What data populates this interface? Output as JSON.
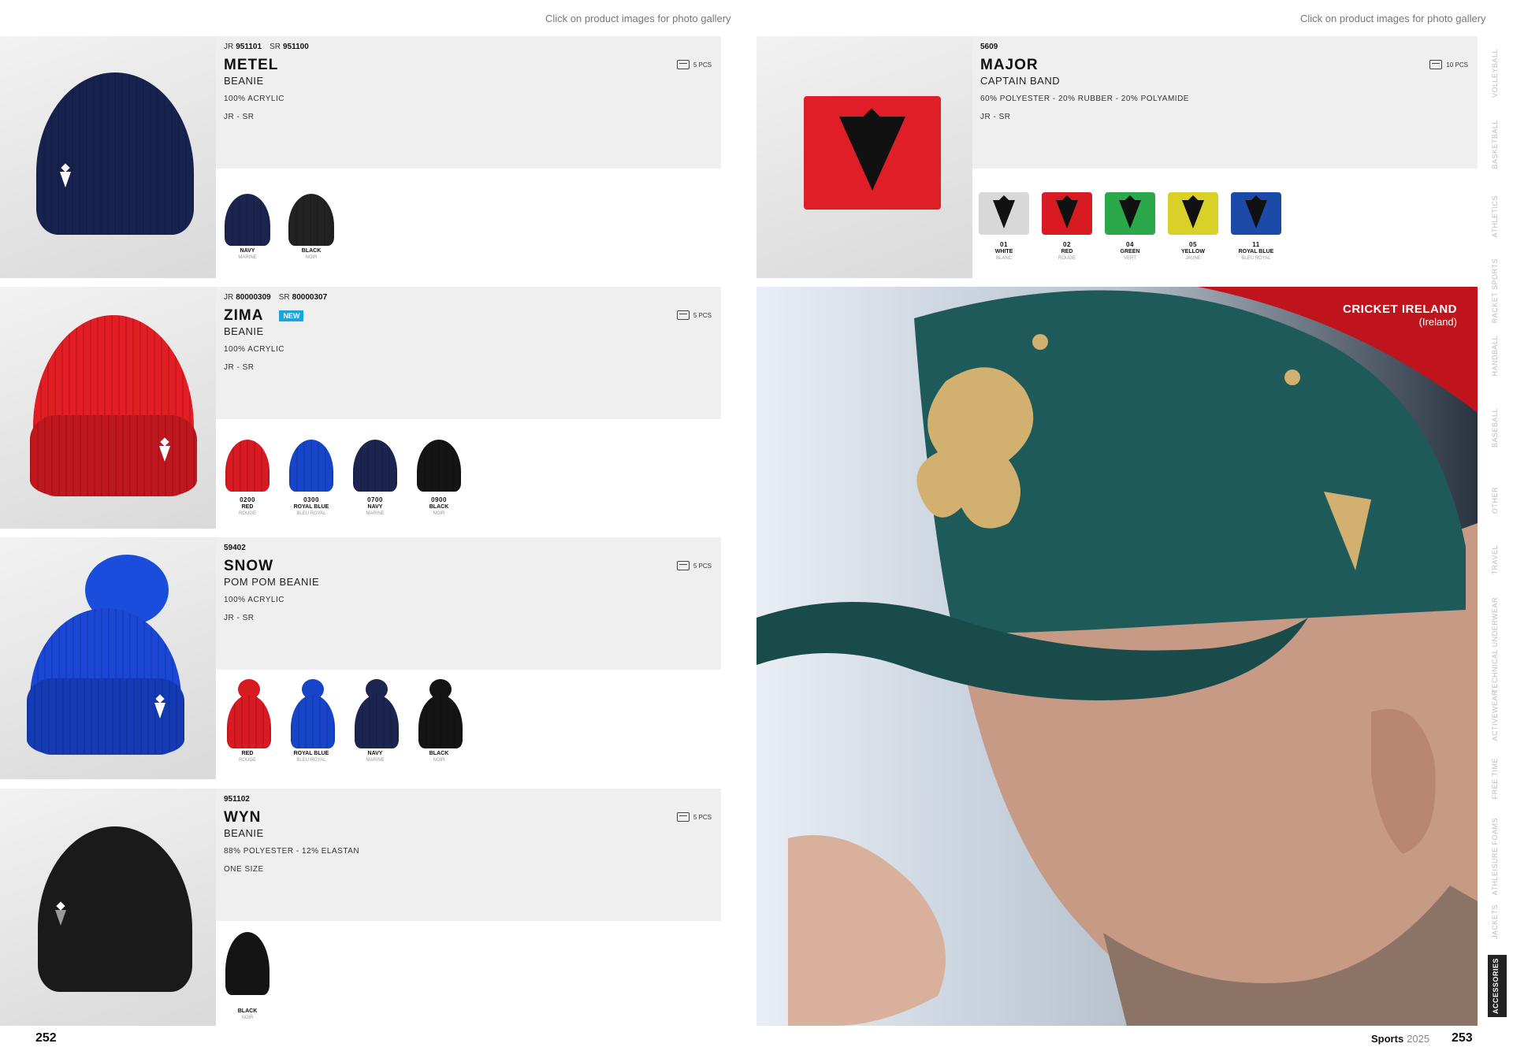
{
  "header": {
    "hint_left": "Click on product images for photo gallery",
    "hint_right": "Click on product images for photo gallery"
  },
  "products": [
    {
      "codes": [
        {
          "k": "JR",
          "v": "951101"
        },
        {
          "k": "SR",
          "v": "951100"
        }
      ],
      "name": "METEL",
      "badge": "",
      "type": "BEANIE",
      "material": "100% ACRYLIC",
      "size": "JR - SR",
      "pack": "5 PCS",
      "swatches": [
        {
          "code": "",
          "name": "NAVY",
          "fr": "MARINE",
          "color": "#1c2550"
        },
        {
          "code": "",
          "name": "BLACK",
          "fr": "NOIR",
          "color": "#1a1a1a"
        }
      ]
    },
    {
      "codes": [
        {
          "k": "JR",
          "v": "80000309"
        },
        {
          "k": "SR",
          "v": "80000307"
        }
      ],
      "name": "ZIMA",
      "badge": "NEW",
      "type": "BEANIE",
      "material": "100% ACRYLIC",
      "size": "JR - SR",
      "pack": "5 PCS",
      "swatches": [
        {
          "code": "0200",
          "name": "RED",
          "fr": "ROUGE",
          "color": "#d81b22"
        },
        {
          "code": "0300",
          "name": "ROYAL BLUE",
          "fr": "BLEU ROYAL",
          "color": "#1745c9"
        },
        {
          "code": "0700",
          "name": "NAVY",
          "fr": "MARINE",
          "color": "#1c2550"
        },
        {
          "code": "0900",
          "name": "BLACK",
          "fr": "NOIR",
          "color": "#141414"
        }
      ]
    },
    {
      "codes": [
        {
          "k": "",
          "v": "59402"
        }
      ],
      "name": "SNOW",
      "badge": "",
      "type": "POM POM BEANIE",
      "material": "100% ACRYLIC",
      "size": "JR - SR",
      "pack": "5 PCS",
      "swatches": [
        {
          "code": "",
          "name": "RED",
          "fr": "ROUGE",
          "color": "#d81b22"
        },
        {
          "code": "",
          "name": "ROYAL BLUE",
          "fr": "BLEU ROYAL",
          "color": "#1745c9"
        },
        {
          "code": "",
          "name": "NAVY",
          "fr": "MARINE",
          "color": "#1c2550"
        },
        {
          "code": "",
          "name": "BLACK",
          "fr": "NOIR",
          "color": "#141414"
        }
      ]
    },
    {
      "codes": [
        {
          "k": "",
          "v": "951102"
        }
      ],
      "name": "WYN",
      "badge": "",
      "type": "BEANIE",
      "material": "88% POLYESTER - 12% ELASTAN",
      "size": "ONE SIZE",
      "pack": "5 PCS",
      "swatches": [
        {
          "code": "",
          "name": "BLACK",
          "fr": "NOIR",
          "color": "#141414"
        }
      ]
    },
    {
      "codes": [
        {
          "k": "",
          "v": "5609"
        }
      ],
      "name": "MAJOR",
      "badge": "",
      "type": "CAPTAIN BAND",
      "material": "60% POLYESTER - 20% RUBBER - 20% POLYAMIDE",
      "size": "JR - SR",
      "pack": "10 PCS",
      "swatches": [
        {
          "code": "01",
          "name": "WHITE",
          "fr": "BLANC",
          "color": "#d8d8d8"
        },
        {
          "code": "02",
          "name": "RED",
          "fr": "ROUGE",
          "color": "#d81b22"
        },
        {
          "code": "04",
          "name": "GREEN",
          "fr": "VERT",
          "color": "#2aa84a"
        },
        {
          "code": "05",
          "name": "YELLOW",
          "fr": "JAUNE",
          "color": "#d9d02a"
        },
        {
          "code": "11",
          "name": "ROYAL BLUE",
          "fr": "BLEU ROYAL",
          "color": "#1c4aa8"
        }
      ]
    }
  ],
  "photo": {
    "title": "CRICKET IRELAND",
    "subtitle": "(Ireland)"
  },
  "sidebar": {
    "items": [
      "VOLLEYBALL",
      "BASKETBALL",
      "ATHLETICS",
      "RACKET SPORTS",
      "HANDBALL",
      "BASEBALL",
      "OTHER",
      "TRAVEL",
      "TECHNICAL UNDERWEAR",
      "ACTIVEWEAR",
      "FREE TIME",
      "ATHLEISURE FOAMS",
      "JACKETS",
      "ACCESSORIES"
    ],
    "active": "ACCESSORIES"
  },
  "footer": {
    "page_left": "252",
    "page_right": "253",
    "brand": "Sports",
    "year": "2025"
  }
}
